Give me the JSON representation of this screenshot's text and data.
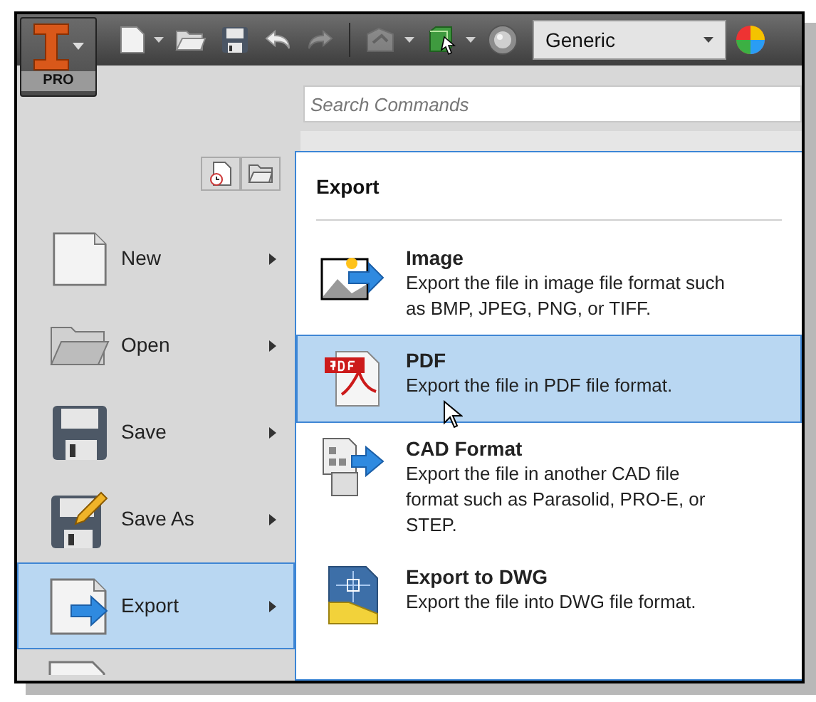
{
  "app_button": {
    "label": "PRO"
  },
  "toolbar": {
    "tools": [
      {
        "kind": "new"
      },
      {
        "kind": "caret"
      },
      {
        "kind": "open"
      },
      {
        "kind": "save"
      },
      {
        "kind": "undo"
      },
      {
        "kind": "redo"
      },
      {
        "kind": "separator"
      },
      {
        "kind": "update"
      },
      {
        "kind": "caret"
      },
      {
        "kind": "select"
      },
      {
        "kind": "caret"
      },
      {
        "kind": "material"
      }
    ],
    "style_dropdown": {
      "value": "Generic"
    }
  },
  "search": {
    "placeholder": "Search Commands"
  },
  "quick_buttons": [
    {
      "kind": "recent"
    },
    {
      "kind": "folder"
    }
  ],
  "menu_items": [
    {
      "kind": "new",
      "label": "New",
      "selected": false
    },
    {
      "kind": "open",
      "label": "Open",
      "selected": false
    },
    {
      "kind": "save",
      "label": "Save",
      "selected": false
    },
    {
      "kind": "saveas",
      "label": "Save As",
      "selected": false
    },
    {
      "kind": "export",
      "label": "Export",
      "selected": true
    }
  ],
  "submenu": {
    "title": "Export",
    "items": [
      {
        "kind": "image",
        "title": "Image",
        "description": [
          "Export the file in image file format such",
          "as BMP, JPEG, PNG, or TIFF."
        ],
        "selected": false
      },
      {
        "kind": "pdf",
        "title": "PDF",
        "description": [
          "Export the file in PDF file format."
        ],
        "selected": true
      },
      {
        "kind": "cad",
        "title": "CAD Format",
        "description": [
          "Export the file in another CAD file",
          "format such as Parasolid, PRO-E, or",
          "STEP."
        ],
        "selected": false
      },
      {
        "kind": "dwg",
        "title": "Export to DWG",
        "description": [
          "Export the file into DWG file format."
        ],
        "selected": false
      }
    ]
  }
}
